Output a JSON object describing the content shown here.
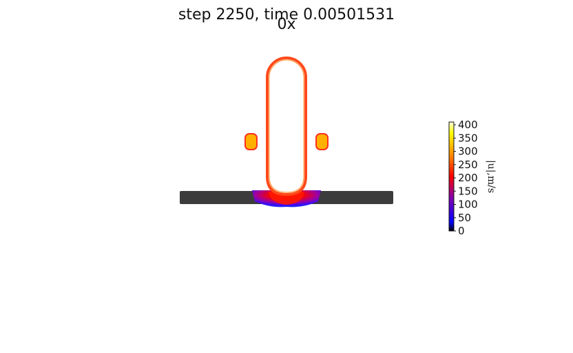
{
  "figure": {
    "title_line1": "step 2250, time 0.00501531",
    "title_line2": "0x"
  },
  "colorbar": {
    "label": "|u|,m/s",
    "ticks": [
      "0",
      "50",
      "100",
      "150",
      "200",
      "250",
      "300",
      "350",
      "400"
    ],
    "min": 0,
    "max": 400,
    "colormap": [
      "#000000",
      "#0000ff",
      "#8000b0",
      "#ff0000",
      "#ff8000",
      "#ffff00",
      "#ffffe0"
    ]
  },
  "scene": {
    "plate_color": "#3c3c3c",
    "projectile_edge_color": "#ff4a1a",
    "fragment_color": "#ffb000"
  }
}
